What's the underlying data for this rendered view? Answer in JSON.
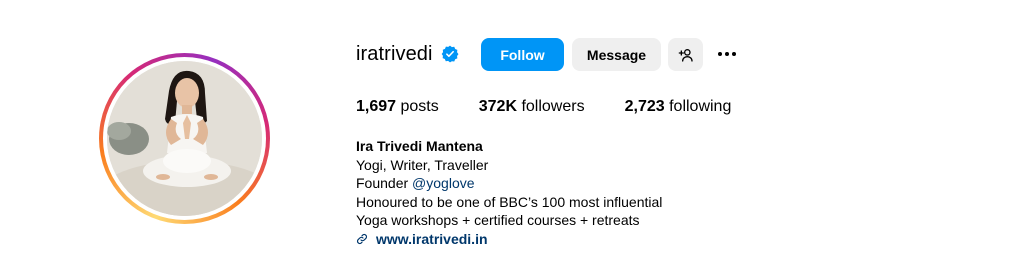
{
  "profile": {
    "username": "iratrivedi",
    "verified": true,
    "follow_label": "Follow",
    "message_label": "Message"
  },
  "stats": {
    "posts_count": "1,697",
    "posts_label": "posts",
    "followers_count": "372K",
    "followers_label": "followers",
    "following_count": "2,723",
    "following_label": "following"
  },
  "bio": {
    "full_name": "Ira Trivedi Mantena",
    "line1": "Yogi, Writer, Traveller",
    "line2_prefix": "Founder ",
    "line2_mention": "@yoglove",
    "line3": "Honoured to be one of BBC’s 100 most influential",
    "line4": "Yoga workshops + certified courses + retreats",
    "link": "www.iratrivedi.in"
  },
  "icons": {
    "verified": "verified-badge-icon",
    "suggest": "add-person-icon",
    "more": "more-options-icon",
    "link": "link-icon"
  },
  "colors": {
    "follow_button": "#0095f6",
    "secondary_button": "#efefef",
    "link_text": "#00376b",
    "verified_badge": "#0095f6"
  }
}
